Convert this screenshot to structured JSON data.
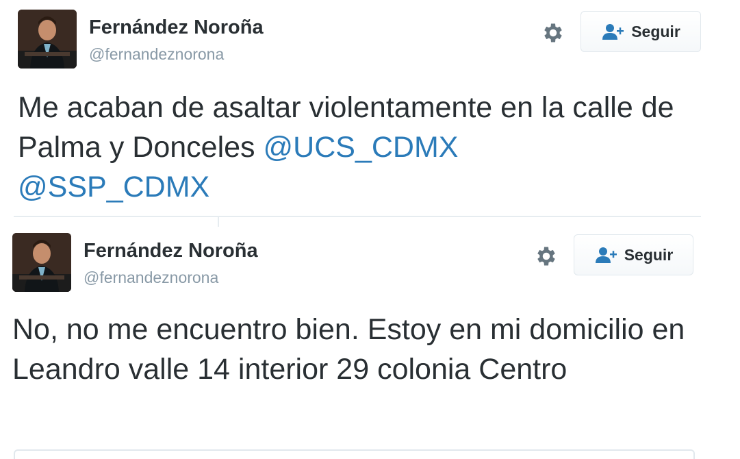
{
  "tweets": [
    {
      "author_name": "Fernández Noroña",
      "handle": "@fernandeznorona",
      "follow_label": "Seguir",
      "icons": [
        "avatar",
        "gear-icon",
        "follow-user-icon"
      ],
      "text_parts": [
        "Me acaban de asaltar violentamente en la calle de Palma y Donceles ",
        "@UCS_CDMX",
        " ",
        "@SSP_CDMX"
      ]
    },
    {
      "author_name": "Fernández Noroña",
      "handle": "@fernandeznorona",
      "follow_label": "Seguir",
      "icons": [
        "avatar",
        "gear-icon",
        "follow-user-icon"
      ],
      "text": "No, no me encuentro bien. Estoy en mi domicilio en Leandro valle 14 interior 29 colonia Centro"
    }
  ],
  "colors": {
    "mention": "#2b7bb9",
    "handle": "#8899a6",
    "text": "#292f33",
    "follow_icon": "#2b7bb9"
  }
}
